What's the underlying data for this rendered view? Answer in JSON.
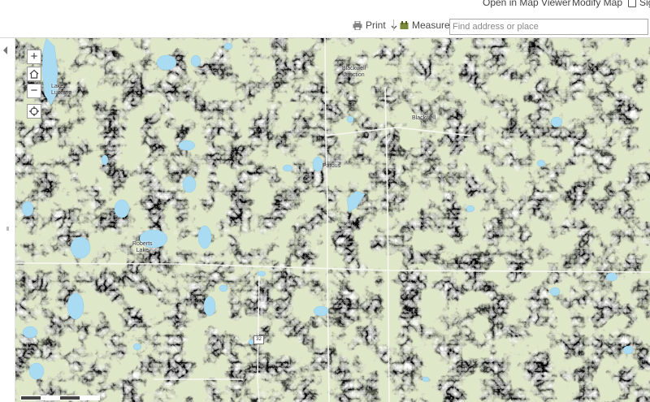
{
  "header": {
    "open_in_map_viewer": "Open in Map Viewer",
    "modify_map": "Modify Map",
    "sign_in": "Sign"
  },
  "toolbar": {
    "print_label": "Print",
    "measure_label": "Measure",
    "search_placeholder": "Find address or place",
    "search_value": ""
  },
  "map": {
    "zoom_in": "+",
    "zoom_out": "−",
    "labels": {
      "lake_lucerne": [
        "Lake",
        "Lucerne"
      ],
      "blackwell_junction": [
        "Blackwell",
        "Junction"
      ],
      "blackwell": "Blackwell",
      "pardus": "Pardus",
      "roberts_lake": [
        "Roberts",
        "Lake"
      ]
    },
    "route_shield": "32",
    "colors": {
      "land": "#dfe7c9",
      "water": "#a9dcf2",
      "hillshade_dark": "#2d2d2d",
      "hillshade_light": "#e4e4e4"
    }
  }
}
